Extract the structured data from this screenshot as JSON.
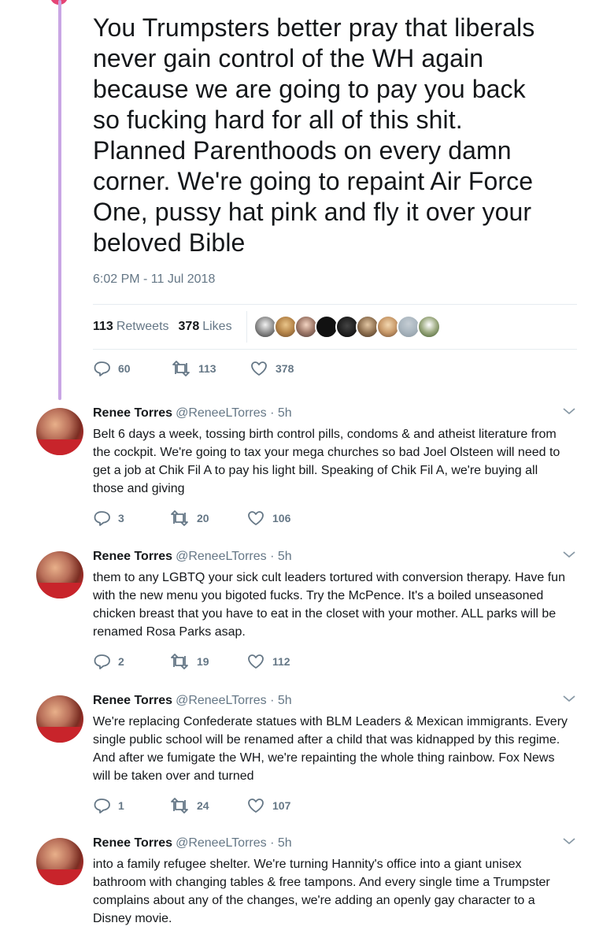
{
  "main_tweet": {
    "text": "You Trumpsters better pray that liberals\nnever gain control of the WH again\nbecause we are going to pay you back\nso fucking hard for all of this shit.\nPlanned Parenthoods on every damn\ncorner. We're going to repaint Air Force\nOne, pussy hat pink and fly it over your\nbeloved Bible",
    "timestamp": "6:02 PM - 11 Jul 2018",
    "retweets_count": "113",
    "retweets_label": "Retweets",
    "likes_count": "378",
    "likes_label": "Likes",
    "actions": {
      "replies": "60",
      "retweets": "113",
      "likes": "378"
    }
  },
  "replies": [
    {
      "name": "Renee Torres",
      "handle": "@ReneeLTorres · 5h",
      "text": "Belt 6 days a week, tossing  birth control pills, condoms &  and atheist literature from the cockpit. We're going to tax  your mega churches so bad  Joel Olsteen will need to get a job at Chik Fil A to pay his light bill. Speaking of Chik Fil A, we're buying all those and giving",
      "replies": "3",
      "retweets": "20",
      "likes": "106"
    },
    {
      "name": "Renee Torres",
      "handle": "@ReneeLTorres · 5h",
      "text": "them to any LGBTQ your sick cult leaders tortured with conversion therapy. Have fun with the new menu you bigoted fucks. Try the McPence. It's a boiled unseasoned chicken breast that you have to eat in the closet with your mother. ALL parks will be renamed Rosa Parks asap.",
      "replies": "2",
      "retweets": "19",
      "likes": "112"
    },
    {
      "name": "Renee Torres",
      "handle": "@ReneeLTorres · 5h",
      "text": "We're replacing Confederate statues with BLM Leaders & Mexican immigrants. Every single public school will be renamed after a child that was kidnapped by this regime. And after we fumigate the WH, we're repainting the whole thing rainbow. Fox News will be taken over and turned",
      "replies": "1",
      "retweets": "24",
      "likes": "107"
    },
    {
      "name": "Renee Torres",
      "handle": "@ReneeLTorres · 5h",
      "text": "into a family refugee shelter.  We're turning Hannity's office into a giant unisex bathroom with changing tables & free tampons. And every single time a Trumpster complains about any of the changes, we're adding an openly gay character to a Disney movie."
    }
  ],
  "colors": {
    "accent_line": "#c9a6e4",
    "secondary_text": "#657786",
    "primary_text": "#14171a"
  }
}
